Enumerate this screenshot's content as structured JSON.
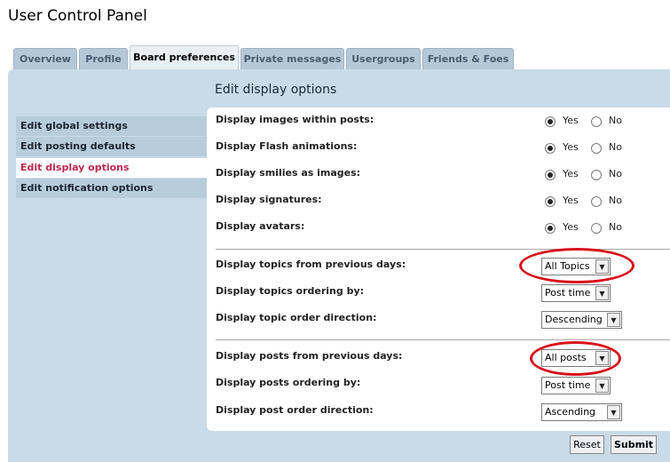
{
  "page_title": "User Control Panel",
  "tabs": [
    {
      "label": "Overview"
    },
    {
      "label": "Profile"
    },
    {
      "label": "Board preferences"
    },
    {
      "label": "Private messages"
    },
    {
      "label": "Usergroups"
    },
    {
      "label": "Friends & Foes"
    }
  ],
  "active_tab": "Board preferences",
  "sidebar": {
    "items": [
      {
        "label": "Edit global settings"
      },
      {
        "label": "Edit posting defaults"
      },
      {
        "label": "Edit display options"
      },
      {
        "label": "Edit notification options"
      }
    ],
    "active": "Edit display options"
  },
  "section_title": "Edit display options",
  "yes_label": "Yes",
  "no_label": "No",
  "radio_settings": [
    {
      "label": "Display images within posts:",
      "value": "Yes"
    },
    {
      "label": "Display Flash animations:",
      "value": "Yes"
    },
    {
      "label": "Display smilies as images:",
      "value": "Yes"
    },
    {
      "label": "Display signatures:",
      "value": "Yes"
    },
    {
      "label": "Display avatars:",
      "value": "Yes"
    }
  ],
  "topic_settings": [
    {
      "label": "Display topics from previous days:",
      "value": "All Topics"
    },
    {
      "label": "Display topics ordering by:",
      "value": "Post time"
    },
    {
      "label": "Display topic order direction:",
      "value": "Descending"
    }
  ],
  "post_settings": [
    {
      "label": "Display posts from previous days:",
      "value": "All posts"
    },
    {
      "label": "Display posts ordering by:",
      "value": "Post time"
    },
    {
      "label": "Display post order direction:",
      "value": "Ascending"
    }
  ],
  "buttons": {
    "reset": "Reset",
    "submit": "Submit"
  },
  "colors": {
    "panel_bg": "#c9dbe8",
    "active_sidebar_text": "#bc2a4d",
    "highlight_ellipse": "#d8101c"
  }
}
